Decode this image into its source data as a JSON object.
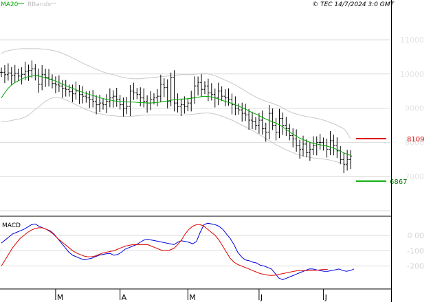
{
  "header": {
    "legend_ma": "MA20",
    "legend_bands": "BBands",
    "copyright": "© TEC 14/7/2024 3:0 GMT"
  },
  "colors": {
    "price": "#000000",
    "ma": "#00aa00",
    "bands": "#c8c8c8",
    "macd": "#0000dd",
    "signal": "#dd0000",
    "resistance": "#dd0000",
    "support": "#00aa00",
    "grid": "#d9d9d9"
  },
  "chart_data": [
    {
      "type": "ohlc",
      "panel": "price",
      "yticks": [
        "11000",
        "10000",
        "9000",
        "8000",
        "7000"
      ],
      "ytick_values": [
        11000,
        10000,
        9000,
        8000,
        7000
      ],
      "ylim": [
        6000,
        11500
      ],
      "xlim": [
        0,
        104
      ],
      "x_tick_labels": [
        "M",
        "A",
        "M",
        "J",
        "J"
      ],
      "x_tick_positions": [
        16,
        35,
        55,
        76,
        95
      ],
      "close": [
        10050,
        9980,
        10030,
        9950,
        10020,
        9940,
        9990,
        10080,
        10100,
        10150,
        9950,
        9700,
        9980,
        9900,
        9850,
        9720,
        9680,
        9650,
        9580,
        9550,
        9480,
        9420,
        9500,
        9400,
        9350,
        9300,
        9250,
        9200,
        9100,
        9150,
        9100,
        9200,
        9300,
        9350,
        9250,
        9100,
        9000,
        9050,
        9500,
        9450,
        9400,
        9300,
        9200,
        9150,
        9250,
        9300,
        9350,
        9700,
        9600,
        9200,
        9900,
        9150,
        9050,
        9100,
        9050,
        9150,
        9300,
        9650,
        9750,
        9550,
        9650,
        9450,
        9400,
        9300,
        9500,
        9350,
        9300,
        9250,
        9100,
        9000,
        8950,
        8850,
        8800,
        8650,
        8600,
        8500,
        8650,
        8400,
        8300,
        8850,
        8500,
        8300,
        8700,
        8500,
        8400,
        8200,
        8100,
        7900,
        7800,
        7950,
        7700,
        7800,
        7900,
        8000,
        8000,
        7900,
        7800,
        8050,
        7900,
        7750,
        7500,
        7350,
        7500,
        7600
      ],
      "ma20": [
        9300,
        9450,
        9580,
        9680,
        9750,
        9800,
        9850,
        9900,
        9920,
        9940,
        9950,
        9940,
        9920,
        9890,
        9860,
        9830,
        9790,
        9750,
        9700,
        9660,
        9620,
        9580,
        9540,
        9500,
        9460,
        9430,
        9400,
        9370,
        9340,
        9310,
        9280,
        9260,
        9240,
        9220,
        9200,
        9190,
        9190,
        9180,
        9180,
        9180,
        9170,
        9160,
        9160,
        9150,
        9150,
        9160,
        9170,
        9180,
        9200,
        9210,
        9230,
        9250,
        9260,
        9270,
        9270,
        9280,
        9290,
        9310,
        9320,
        9340,
        9350,
        9340,
        9330,
        9300,
        9270,
        9230,
        9200,
        9170,
        9140,
        9100,
        9060,
        9010,
        8970,
        8920,
        8870,
        8830,
        8780,
        8730,
        8680,
        8640,
        8600,
        8560,
        8510,
        8450,
        8380,
        8310,
        8240,
        8180,
        8120,
        8080,
        8040,
        8000,
        7970,
        7950,
        7930,
        7910,
        7890,
        7860,
        7830,
        7790,
        7740,
        7690,
        7650,
        7620
      ],
      "bb_upper": [
        10600,
        10650,
        10680,
        10700,
        10720,
        10730,
        10740,
        10740,
        10740,
        10740,
        10740,
        10740,
        10730,
        10720,
        10710,
        10690,
        10670,
        10640,
        10600,
        10560,
        10520,
        10470,
        10420,
        10370,
        10320,
        10270,
        10230,
        10180,
        10140,
        10100,
        10060,
        10030,
        10000,
        9980,
        9950,
        9920,
        9900,
        9880,
        9870,
        9860,
        9860,
        9860,
        9870,
        9880,
        9890,
        9900,
        9910,
        9920,
        9930,
        9940,
        9950,
        9960,
        9970,
        9980,
        9980,
        9980,
        9980,
        9990,
        10000,
        10010,
        10020,
        10000,
        9980,
        9950,
        9910,
        9870,
        9820,
        9780,
        9730,
        9680,
        9620,
        9560,
        9500,
        9440,
        9380,
        9330,
        9280,
        9240,
        9200,
        9170,
        9140,
        9100,
        9060,
        9000,
        8950,
        8900,
        8860,
        8830,
        8800,
        8780,
        8760,
        8740,
        8720,
        8700,
        8680,
        8650,
        8620,
        8580,
        8540,
        8500,
        8450,
        8400,
        8280,
        8100
      ],
      "bb_lower": [
        8600,
        8610,
        8620,
        8640,
        8660,
        8680,
        8700,
        8740,
        8800,
        8880,
        8960,
        9040,
        9120,
        9200,
        9260,
        9300,
        9320,
        9310,
        9280,
        9240,
        9200,
        9150,
        9100,
        9050,
        9000,
        8960,
        8920,
        8890,
        8860,
        8840,
        8820,
        8800,
        8790,
        8780,
        8770,
        8760,
        8760,
        8760,
        8760,
        8770,
        8780,
        8790,
        8800,
        8800,
        8800,
        8800,
        8800,
        8800,
        8800,
        8800,
        8800,
        8800,
        8800,
        8800,
        8800,
        8810,
        8820,
        8830,
        8840,
        8850,
        8860,
        8860,
        8850,
        8830,
        8800,
        8770,
        8730,
        8690,
        8650,
        8600,
        8550,
        8500,
        8450,
        8400,
        8350,
        8290,
        8230,
        8170,
        8110,
        8050,
        7990,
        7930,
        7880,
        7830,
        7780,
        7740,
        7700,
        7660,
        7630,
        7600,
        7580,
        7560,
        7540,
        7530,
        7520,
        7510,
        7500,
        7480,
        7450,
        7430,
        7400,
        7380,
        7390,
        7400
      ],
      "resistance_value": 8109,
      "resistance_label": "8109",
      "support_value": 6867,
      "support_label": "6867"
    },
    {
      "type": "line",
      "panel": "macd",
      "label": "MACD",
      "yticks": [
        "0",
        "-100",
        "-200"
      ],
      "ytick_values": [
        0,
        -100,
        -200
      ],
      "ylim": [
        -300,
        120
      ],
      "series": [
        {
          "name": "MACD",
          "values": [
            -50,
            -30,
            -10,
            10,
            20,
            30,
            40,
            55,
            70,
            75,
            60,
            50,
            40,
            30,
            10,
            -20,
            -50,
            -80,
            -110,
            -130,
            -140,
            -150,
            -160,
            -155,
            -150,
            -140,
            -130,
            -125,
            -120,
            -118,
            -130,
            -125,
            -110,
            -90,
            -80,
            -70,
            -60,
            -45,
            -30,
            -25,
            -30,
            -35,
            -40,
            -45,
            -50,
            -55,
            -60,
            -45,
            -35,
            -40,
            -45,
            -55,
            -40,
            20,
            70,
            80,
            75,
            70,
            60,
            40,
            10,
            -20,
            -60,
            -110,
            -140,
            -160,
            -165,
            -175,
            -180,
            -195,
            -200,
            -210,
            -220,
            -250,
            -280,
            -290,
            -280,
            -270,
            -260,
            -250,
            -240,
            -230,
            -220,
            -220,
            -225,
            -230,
            -235,
            -235,
            -230,
            -225,
            -220,
            -230,
            -235,
            -230,
            -220
          ],
          "x_start": 0
        },
        {
          "name": "Signal",
          "values": [
            -200,
            -160,
            -120,
            -80,
            -50,
            -20,
            0,
            20,
            35,
            45,
            50,
            50,
            40,
            25,
            5,
            -20,
            -40,
            -60,
            -80,
            -100,
            -115,
            -125,
            -135,
            -140,
            -140,
            -135,
            -125,
            -115,
            -110,
            -105,
            -100,
            -90,
            -80,
            -70,
            -65,
            -60,
            -60,
            -60,
            -60,
            -60,
            -70,
            -80,
            -90,
            -100,
            -100,
            -95,
            -85,
            -60,
            -30,
            10,
            40,
            60,
            70,
            70,
            60,
            40,
            20,
            0,
            -30,
            -70,
            -110,
            -150,
            -175,
            -190,
            -200,
            -210,
            -220,
            -230,
            -240,
            -250,
            -255,
            -260,
            -262,
            -260,
            -255,
            -250,
            -245,
            -240,
            -235,
            -230,
            -230,
            -230,
            -230,
            -230,
            -228,
            -225,
            -222,
            -222
          ],
          "x_start": 0
        }
      ]
    }
  ]
}
